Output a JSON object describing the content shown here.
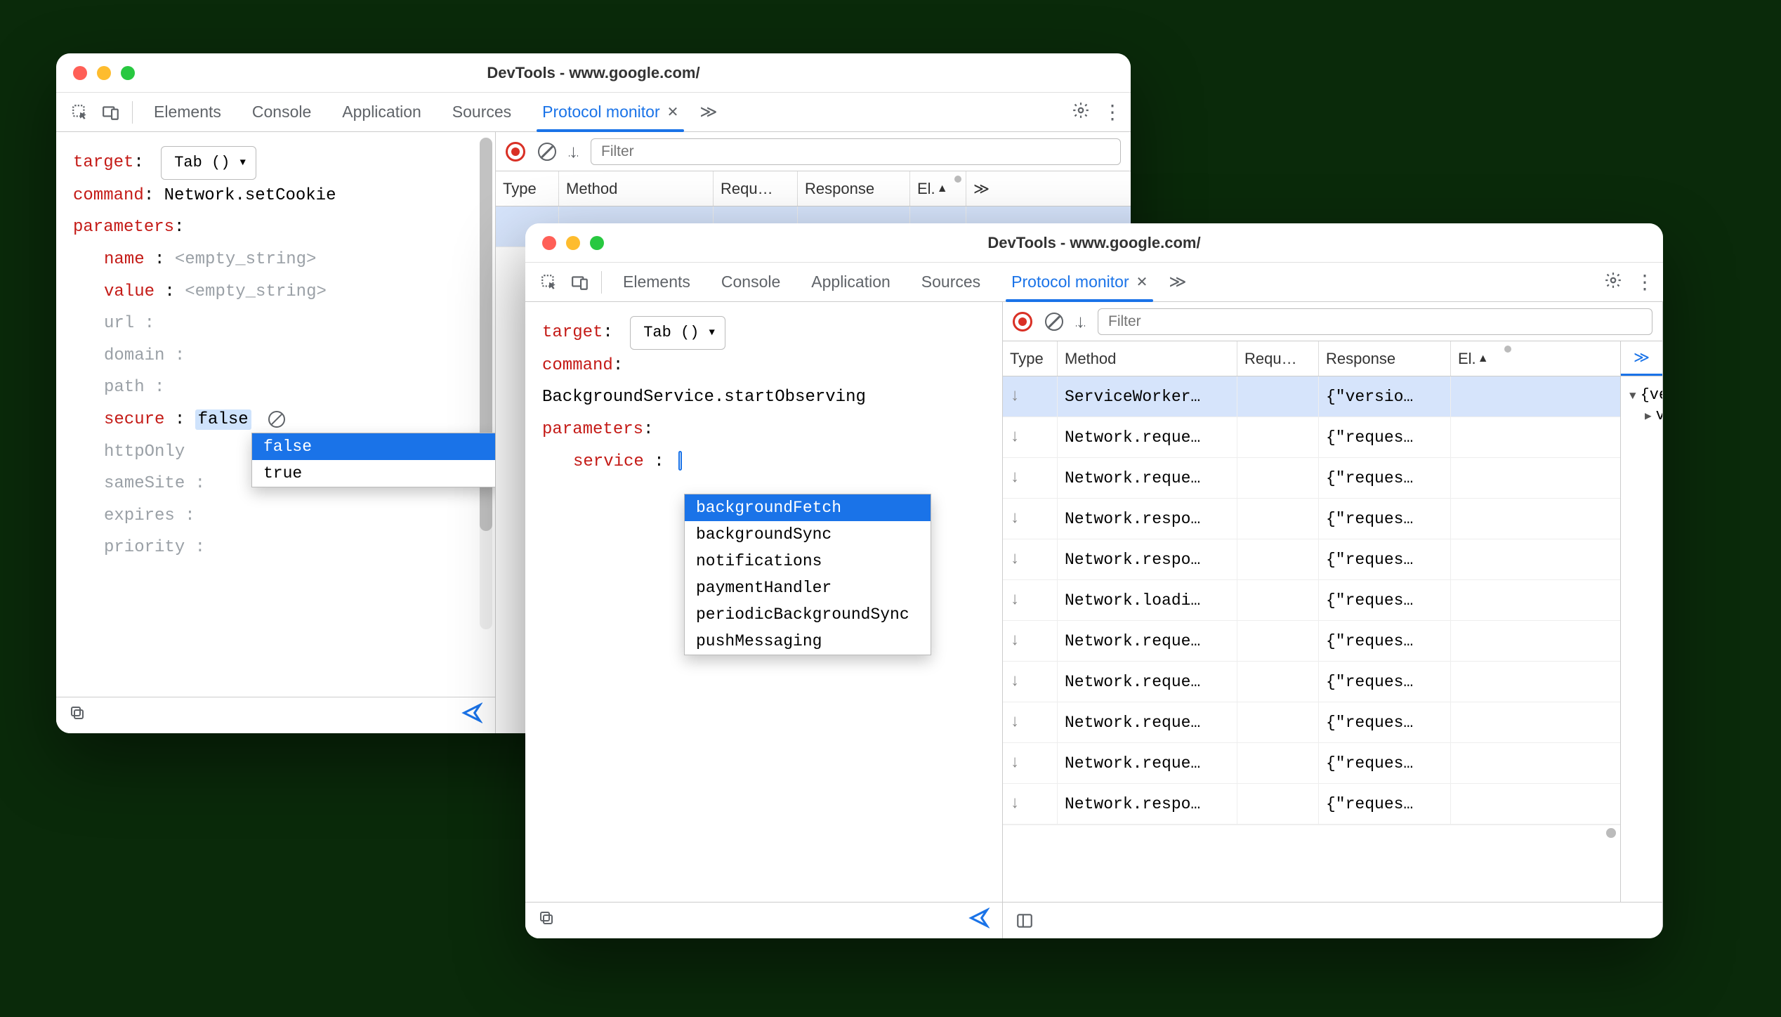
{
  "window1": {
    "title": "DevTools - www.google.com/",
    "tabs": [
      "Elements",
      "Console",
      "Application",
      "Sources",
      "Protocol monitor"
    ],
    "active_tab": "Protocol monitor",
    "editor": {
      "target_label": "target",
      "target_select": "Tab ()",
      "command_label": "command",
      "command_value": "Network.setCookie",
      "parameters_label": "parameters",
      "params": {
        "name": "name",
        "name_val": "<empty_string>",
        "value": "value",
        "value_val": "<empty_string>",
        "url": "url",
        "domain": "domain",
        "path": "path",
        "secure": "secure",
        "secure_val": "false",
        "httpOnly": "httpOnly",
        "sameSite": "sameSite",
        "expires": "expires",
        "priority": "priority"
      },
      "dropdown": {
        "options": [
          "false",
          "true"
        ],
        "selected": "false"
      }
    },
    "filter_placeholder": "Filter",
    "grid": {
      "headers": {
        "type": "Type",
        "method": "Method",
        "request": "Requ…",
        "response": "Response",
        "elapsed": "El.",
        "more": "≫"
      }
    }
  },
  "window2": {
    "title": "DevTools - www.google.com/",
    "tabs": [
      "Elements",
      "Console",
      "Application",
      "Sources",
      "Protocol monitor"
    ],
    "active_tab": "Protocol monitor",
    "editor": {
      "target_label": "target",
      "target_select": "Tab ()",
      "command_label": "command",
      "command_value": "BackgroundService.startObserving",
      "parameters_label": "parameters",
      "service_label": "service",
      "dropdown": {
        "options": [
          "backgroundFetch",
          "backgroundSync",
          "notifications",
          "paymentHandler",
          "periodicBackgroundSync",
          "pushMessaging"
        ],
        "selected": "backgroundFetch"
      }
    },
    "filter_placeholder": "Filter",
    "grid": {
      "headers": {
        "type": "Type",
        "method": "Method",
        "request": "Requ…",
        "response": "Response",
        "elapsed": "El.",
        "more": "≫"
      },
      "rows": [
        {
          "method": "ServiceWorker…",
          "response": "{\"versio…",
          "selected": true
        },
        {
          "method": "Network.reque…",
          "response": "{\"reques…"
        },
        {
          "method": "Network.reque…",
          "response": "{\"reques…"
        },
        {
          "method": "Network.respo…",
          "response": "{\"reques…"
        },
        {
          "method": "Network.respo…",
          "response": "{\"reques…"
        },
        {
          "method": "Network.loadi…",
          "response": "{\"reques…"
        },
        {
          "method": "Network.reque…",
          "response": "{\"reques…"
        },
        {
          "method": "Network.reque…",
          "response": "{\"reques…"
        },
        {
          "method": "Network.reque…",
          "response": "{\"reques…"
        },
        {
          "method": "Network.reque…",
          "response": "{\"reques…"
        },
        {
          "method": "Network.respo…",
          "response": "{\"reques…"
        }
      ]
    },
    "response_tree": {
      "root": "{vers",
      "child": "ver"
    }
  }
}
